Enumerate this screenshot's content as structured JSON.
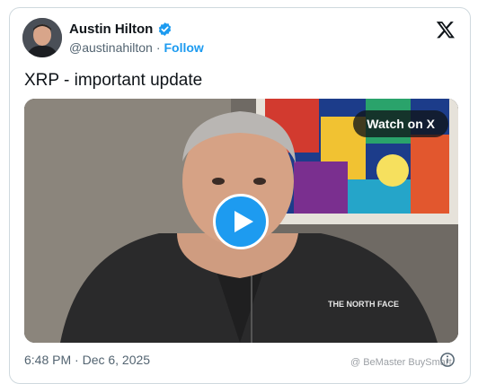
{
  "author": {
    "name": "Austin Hilton",
    "handle": "@austinahilton",
    "separator": "·",
    "follow_label": "Follow",
    "verified_color": "#1d9bf0"
  },
  "platform_icon": "x-logo-icon",
  "tweet": {
    "text": "XRP - important update"
  },
  "video": {
    "watch_label": "Watch on X",
    "play_icon": "play-icon"
  },
  "footer": {
    "timestamp": "6:48 PM · Dec 6, 2025",
    "info_icon": "info-icon"
  },
  "watermark": {
    "text": "@ BeMaster BuySmart"
  },
  "colors": {
    "accent": "#1d9bf0",
    "text": "#0f1419",
    "muted": "#536471",
    "border": "#cfd9de"
  }
}
